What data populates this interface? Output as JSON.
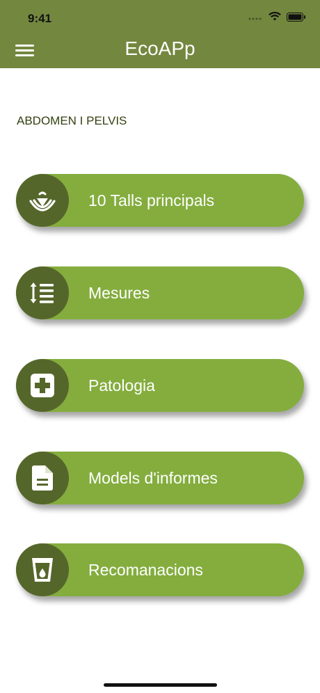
{
  "status_bar": {
    "time": "9:41"
  },
  "header": {
    "title": "EcoAPp"
  },
  "section": {
    "title": "ABDOMEN I PELVIS"
  },
  "menu_items": [
    {
      "label": "10 Talls principals",
      "icon": "ultrasound-icon"
    },
    {
      "label": "Mesures",
      "icon": "measure-list-icon"
    },
    {
      "label": "Patologia",
      "icon": "medical-cross-icon"
    },
    {
      "label": "Models d'informes",
      "icon": "document-icon"
    },
    {
      "label": "Recomanacions",
      "icon": "cup-drop-icon"
    }
  ],
  "colors": {
    "header": "#74873f",
    "button": "#84ad3e",
    "icon_circle": "#55662b",
    "section_text": "#344011"
  }
}
